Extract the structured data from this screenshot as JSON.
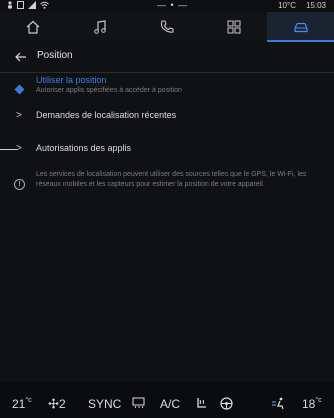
{
  "status": {
    "center": "— • —",
    "temperature": "10°C",
    "time": "15:03"
  },
  "nav": {
    "tabs": [
      {
        "name": "home-icon"
      },
      {
        "name": "music-icon"
      },
      {
        "name": "phone-icon"
      },
      {
        "name": "apps-icon"
      },
      {
        "name": "car-icon",
        "active": true
      }
    ]
  },
  "page": {
    "title": "Position",
    "use_location": {
      "title": "Utiliser la position",
      "subtitle": "Autoriser applis spécifiées à accéder à position"
    },
    "recent_requests": "Demandes de localisation récentes",
    "app_permissions": "Autorisations des applis",
    "info": "Les services de localisation peuvent utiliser des sources telles que le GPS, le Wi-Fi, les réseaux mobiles et les capteurs pour estimer la position de votre appareil."
  },
  "bottom": {
    "temp_left": "21",
    "temp_left_unit": "°c",
    "fan_level": "2",
    "sync": "SYNC",
    "ac": "A/C",
    "temp_right": "18",
    "temp_right_unit": "°c"
  }
}
